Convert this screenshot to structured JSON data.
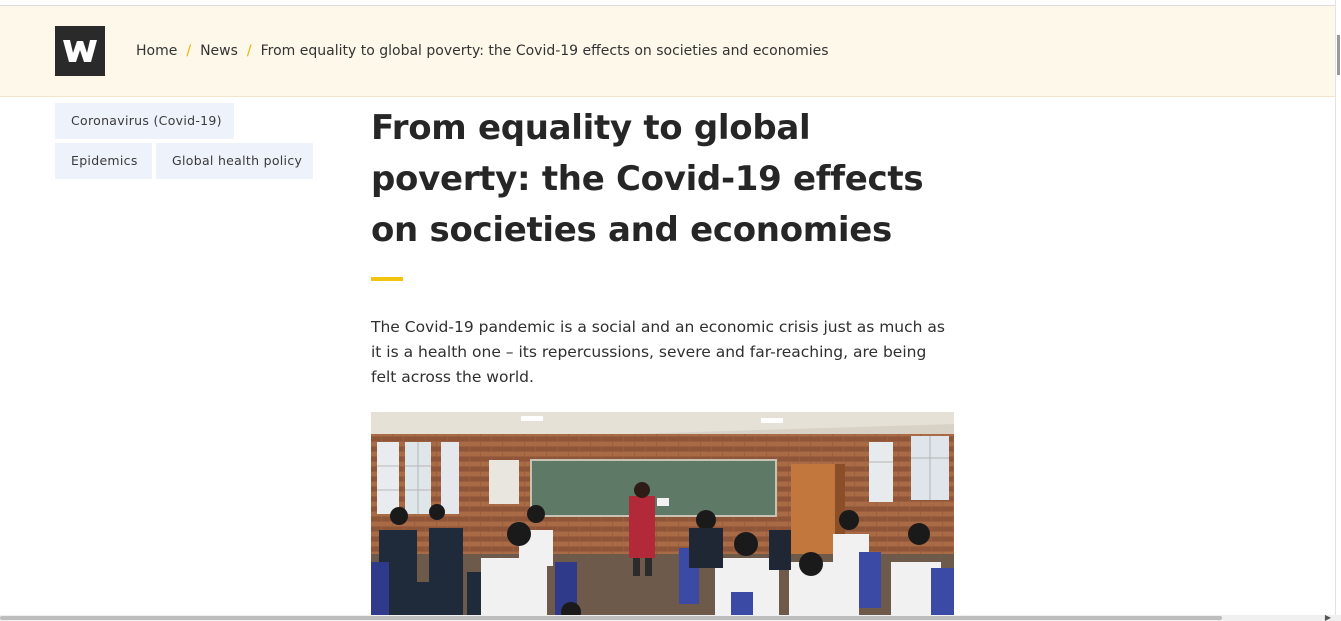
{
  "breadcrumb": {
    "home": "Home",
    "news": "News",
    "current": "From equality to global poverty: the Covid-19 effects on societies and economies",
    "separator": "/"
  },
  "tags": [
    "Coronavirus (Covid-19)",
    "Epidemics",
    "Global health policy"
  ],
  "article": {
    "title": "From equality to global poverty: the Covid-19 effects on societies and economies",
    "lead": "The Covid-19 pandemic is a social and an economic crisis just as much as it is a health one – its repercussions, severe and far-reaching, are being felt across the world."
  },
  "colors": {
    "header_bg": "#fdf8ea",
    "accent": "#f1c40f",
    "tag_bg": "#eef3fb",
    "logo_bg": "#2a2a2a"
  },
  "icons": {
    "logo": "w-logo-icon"
  }
}
